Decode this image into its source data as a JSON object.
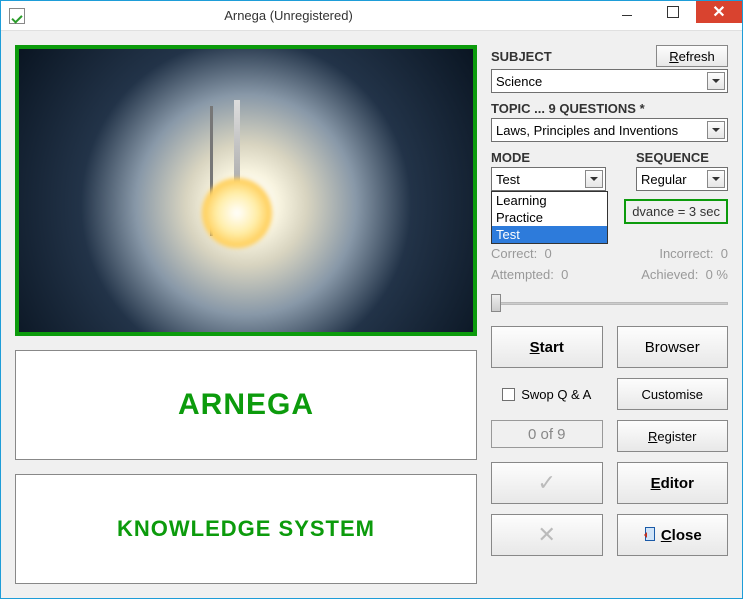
{
  "window": {
    "title": "Arnega (Unregistered)"
  },
  "left": {
    "title1": "ARNEGA",
    "title2": "KNOWLEDGE SYSTEM"
  },
  "right": {
    "subject_label": "SUBJECT",
    "refresh": "Refresh",
    "subject_value": "Science",
    "topic_label": "TOPIC  ...  9  QUESTIONS *",
    "topic_value": "Laws, Principles and Inventions",
    "mode_label": "MODE",
    "mode_value": "Test",
    "mode_options": {
      "o1": "Learning",
      "o2": "Practice",
      "o3": "Test"
    },
    "sequence_label": "SEQUENCE",
    "sequence_value": "Regular",
    "advance_text": "dvance   =   3 sec",
    "stats": {
      "correct_label": "Correct:",
      "correct_val": "0",
      "incorrect_label": "Incorrect:",
      "incorrect_val": "0",
      "attempted_label": "Attempted:",
      "attempted_val": "0",
      "achieved_label": "Achieved:",
      "achieved_val": "0 %"
    },
    "buttons": {
      "start_prefix": "S",
      "start_suffix": "tart",
      "browser": "Browser",
      "swop": "Swop Q & A",
      "customise": "Customise",
      "counter": "0  of  9",
      "register_prefix": "R",
      "register_suffix": "egister",
      "editor_prefix": "E",
      "editor_suffix": "ditor",
      "close_prefix": "C",
      "close_suffix": "lose"
    }
  }
}
